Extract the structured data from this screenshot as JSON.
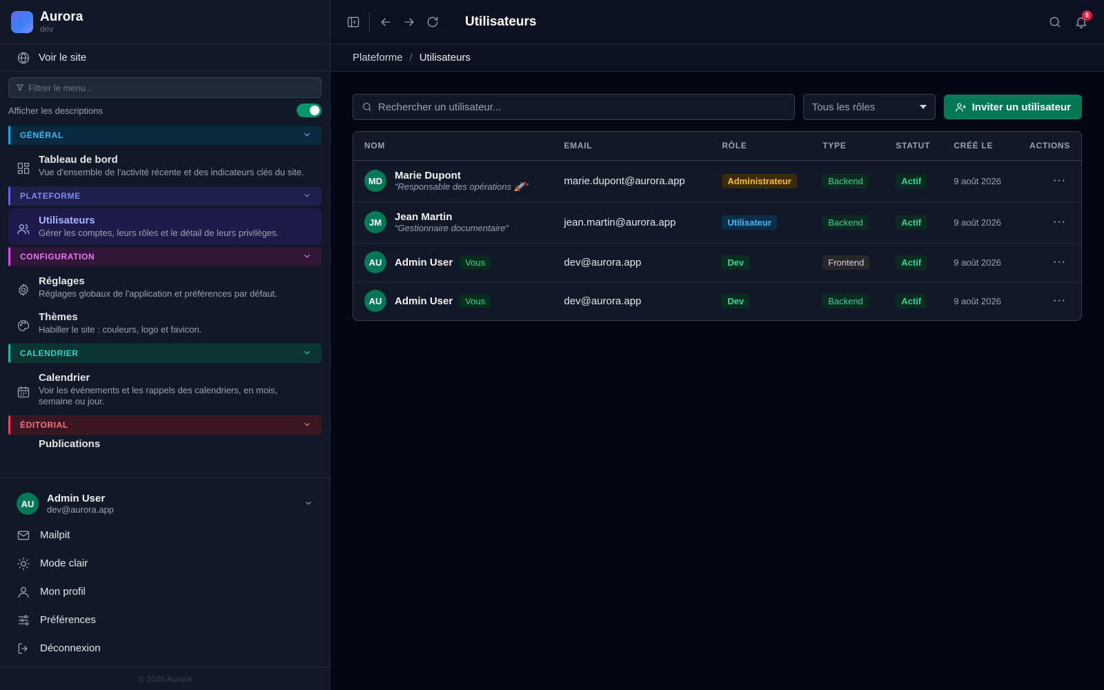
{
  "brand": {
    "name": "Aurora",
    "env": "dev"
  },
  "sidebar": {
    "view_site": "Voir le site",
    "filter_placeholder": "Filtrer le menu...",
    "show_descriptions": "Afficher les descriptions",
    "show_descriptions_on": true,
    "sections": [
      {
        "label": "GÉNÉRAL",
        "items": [
          {
            "title": "Tableau de bord",
            "desc": "Vue d'ensemble de l'activité récente et des indicateurs clés du site.",
            "icon": "dashboard-icon"
          }
        ]
      },
      {
        "label": "PLATEFORME",
        "items": [
          {
            "title": "Utilisateurs",
            "desc": "Gérer les comptes, leurs rôles et le détail de leurs privilèges.",
            "icon": "users-icon",
            "active": true
          }
        ]
      },
      {
        "label": "CONFIGURATION",
        "items": [
          {
            "title": "Réglages",
            "desc": "Réglages globaux de l'application et préférences par défaut.",
            "icon": "gear-icon"
          },
          {
            "title": "Thèmes",
            "desc": "Habiller le site : couleurs, logo et favicon.",
            "icon": "palette-icon"
          }
        ]
      },
      {
        "label": "CALENDRIER",
        "items": [
          {
            "title": "Calendrier",
            "desc": "Voir les événements et les rappels des calendriers, en mois, semaine ou jour.",
            "icon": "calendar-icon"
          }
        ]
      },
      {
        "label": "ÉDITORIAL",
        "items": [
          {
            "title": "Publications"
          }
        ]
      }
    ]
  },
  "user": {
    "initials": "AU",
    "name": "Admin User",
    "email": "dev@aurora.app"
  },
  "bottom_links": [
    "Mailpit",
    "Mode clair",
    "Mon profil",
    "Préférences",
    "Déconnexion"
  ],
  "copyright": "© 2026 Aurora",
  "topbar": {
    "title": "Utilisateurs",
    "notifications": "8"
  },
  "breadcrumb": {
    "parent": "Plateforme",
    "separator": "/",
    "current": "Utilisateurs"
  },
  "toolbar": {
    "search_placeholder": "Rechercher un utilisateur...",
    "role_select": "Tous les rôles",
    "invite_label": "Inviter un utilisateur"
  },
  "table": {
    "columns": [
      "NOM",
      "EMAIL",
      "RÔLE",
      "TYPE",
      "STATUT",
      "CRÉÉ LE",
      "ACTIONS"
    ],
    "rows": [
      {
        "initials": "MD",
        "name": "Marie Dupont",
        "subtitle": "“Responsable des opérations 🚀”",
        "email": "marie.dupont@aurora.app",
        "role": "Administrateur",
        "type": "Backend",
        "status": "Actif",
        "created": "9 août 2026"
      },
      {
        "initials": "JM",
        "name": "Jean Martin",
        "subtitle": "“Gestionnaire documentaire”",
        "email": "jean.martin@aurora.app",
        "role": "Utilisateur",
        "type": "Backend",
        "status": "Actif",
        "created": "9 août 2026"
      },
      {
        "initials": "AU",
        "name": "Admin User",
        "you": "Vous",
        "email": "dev@aurora.app",
        "role": "Dev",
        "type": "Frontend",
        "status": "Actif",
        "created": "9 août 2026"
      },
      {
        "initials": "AU",
        "name": "Admin User",
        "you": "Vous",
        "email": "dev@aurora.app",
        "role": "Dev",
        "type": "Backend",
        "status": "Actif",
        "created": "9 août 2026"
      }
    ],
    "row_action_glyph": "···"
  },
  "colors": {
    "accent": "#047857",
    "badge_danger": "#e11d48",
    "active_item": "#a5b4fc"
  }
}
